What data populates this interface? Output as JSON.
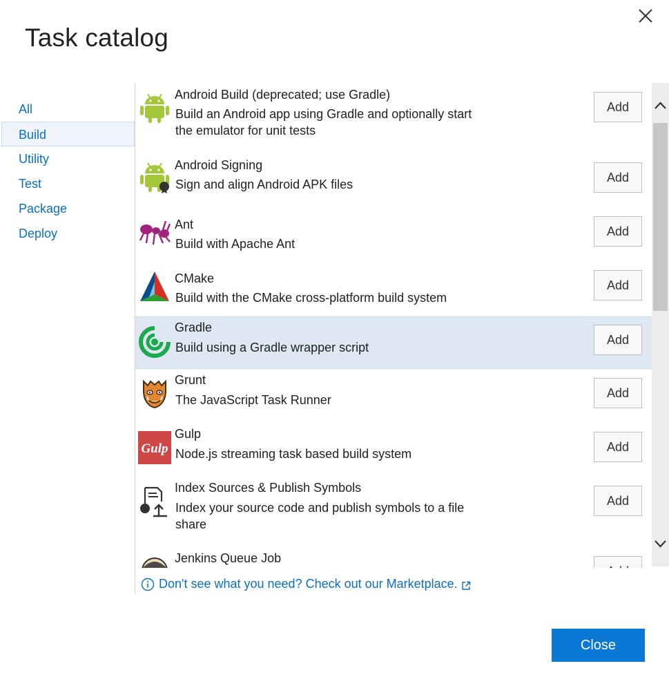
{
  "dialog": {
    "title": "Task catalog",
    "close_icon": "close-icon"
  },
  "sidebar": {
    "items": [
      {
        "label": "All",
        "selected": false
      },
      {
        "label": "Build",
        "selected": true
      },
      {
        "label": "Utility",
        "selected": false
      },
      {
        "label": "Test",
        "selected": false
      },
      {
        "label": "Package",
        "selected": false
      },
      {
        "label": "Deploy",
        "selected": false
      }
    ]
  },
  "tasks": [
    {
      "name": "Android Build (deprecated; use Gradle)",
      "description": "Build an Android app using Gradle and optionally start the emulator for unit tests",
      "icon": "android-icon",
      "add_label": "Add"
    },
    {
      "name": "Android Signing",
      "description": "Sign and align Android APK files",
      "icon": "android-signing-icon",
      "add_label": "Add"
    },
    {
      "name": "Ant",
      "description": "Build with Apache Ant",
      "icon": "ant-icon",
      "add_label": "Add"
    },
    {
      "name": "CMake",
      "description": "Build with the CMake cross-platform build system",
      "icon": "cmake-icon",
      "add_label": "Add"
    },
    {
      "name": "Gradle",
      "description": "Build using a Gradle wrapper script",
      "icon": "gradle-icon",
      "add_label": "Add",
      "selected": true
    },
    {
      "name": "Grunt",
      "description": "The JavaScript Task Runner",
      "icon": "grunt-icon",
      "add_label": "Add"
    },
    {
      "name": "Gulp",
      "description": "Node.js streaming task based build system",
      "icon": "gulp-icon",
      "icon_text": "Gulp",
      "add_label": "Add"
    },
    {
      "name": "Index Sources & Publish Symbols",
      "description": "Index your source code and publish symbols to a file share",
      "icon": "index-sources-icon",
      "add_label": "Add"
    },
    {
      "name": "Jenkins Queue Job",
      "description": "",
      "icon": "jenkins-icon",
      "add_label": "Add"
    }
  ],
  "footer": {
    "marketplace_link": "Don't see what you need? Check out our Marketplace."
  },
  "buttons": {
    "close_label": "Close"
  },
  "colors": {
    "accent": "#0a78d4",
    "link": "#0a6fc2",
    "selected_row": "#dfe7f2"
  }
}
